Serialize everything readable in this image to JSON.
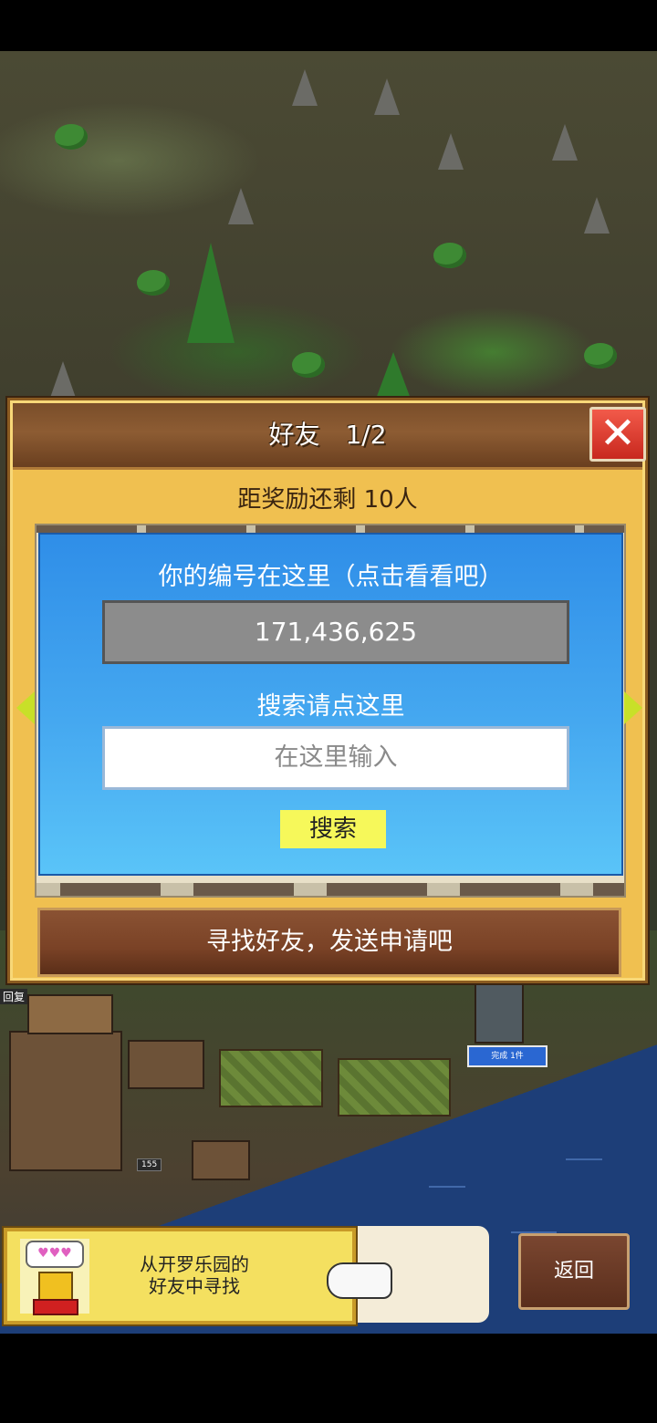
{
  "dialog": {
    "title": "好友　1/2",
    "close_icon": "close-icon",
    "reward_remaining": "距奖励还剩 10人",
    "id_label": "你的编号在这里（点击看看吧）",
    "id_value": "171,436,625",
    "search_label": "搜索请点这里",
    "search_placeholder": "在这里输入",
    "search_button": "搜索",
    "find_friends_button": "寻找好友，发送申请吧"
  },
  "world": {
    "done_tag": "完成 1件",
    "hp_tag": "回复",
    "number_tag": "155"
  },
  "bottom": {
    "banner_text_line1": "从开罗乐园的",
    "banner_text_line2": "好友中寻找",
    "back_button": "返回",
    "hearts": "♥♥♥"
  },
  "colors": {
    "panel_blue": "#2f8ee8",
    "dialog_gold": "#f0c050",
    "button_brown": "#7a4226",
    "search_yellow": "#f6f85a",
    "close_red": "#e0382a"
  }
}
